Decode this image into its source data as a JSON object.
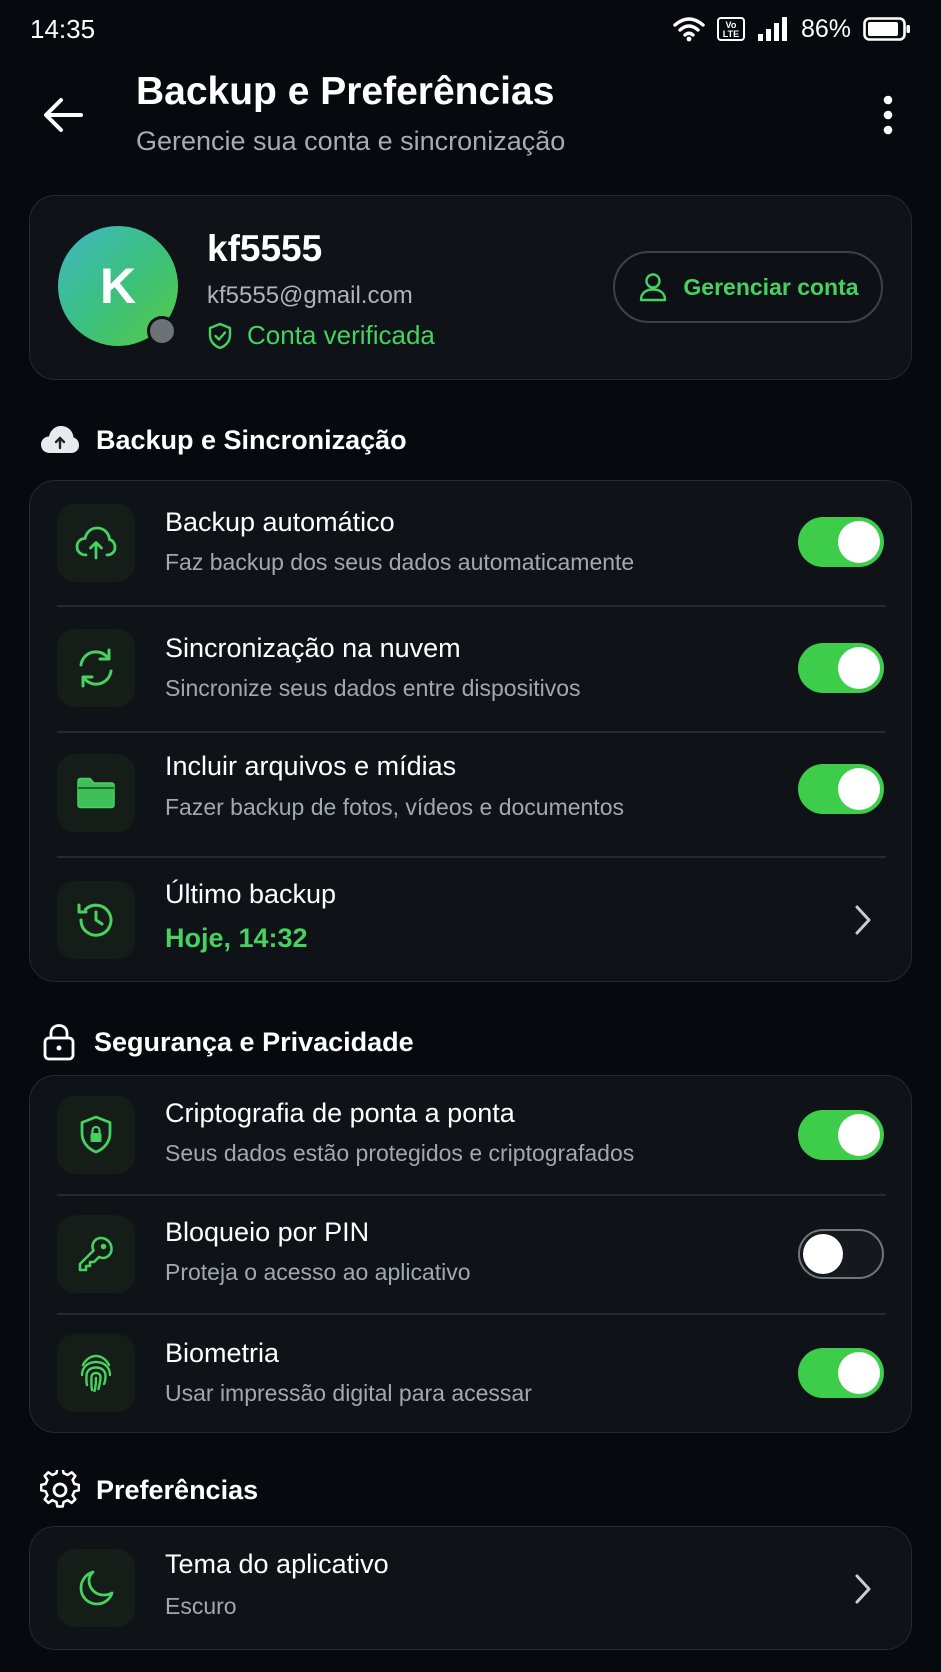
{
  "status_bar": {
    "time": "14:35",
    "volte": "Vo LTE",
    "battery": "86%"
  },
  "header": {
    "title": "Backup e Preferências",
    "subtitle": "Gerencie sua conta e sincronização"
  },
  "profile": {
    "initial": "K",
    "name": "kf5555",
    "email": "kf5555@gmail.com",
    "verified_label": "Conta verificada",
    "manage_label": "Gerenciar conta"
  },
  "sections": {
    "backup": {
      "title": "Backup e Sincronização",
      "items": [
        {
          "title": "Backup automático",
          "subtitle": "Faz backup dos seus dados automaticamente",
          "enabled": true
        },
        {
          "title": "Sincronização na nuvem",
          "subtitle": "Sincronize seus dados entre dispositivos",
          "enabled": true
        },
        {
          "title": "Incluir arquivos e mídias",
          "subtitle": "Fazer backup de fotos, vídeos e documentos",
          "enabled": true
        },
        {
          "title": "Último backup",
          "subtitle": "Hoje, 14:32"
        }
      ]
    },
    "security": {
      "title": "Segurança e Privacidade",
      "items": [
        {
          "title": "Criptografia de ponta a ponta",
          "subtitle": "Seus dados estão protegidos e criptografados",
          "enabled": true
        },
        {
          "title": "Bloqueio por PIN",
          "subtitle": "Proteja o acesso ao aplicativo",
          "enabled": false
        },
        {
          "title": "Biometria",
          "subtitle": "Usar impressão digital para acessar",
          "enabled": true
        }
      ]
    },
    "preferences": {
      "title": "Preferências",
      "items": [
        {
          "title": "Tema do aplicativo",
          "subtitle": "Escuro"
        }
      ]
    }
  },
  "colors": {
    "accent": "#46d160",
    "toggle_on": "#3ecc4b",
    "card_bg": "#0f1318",
    "page_bg": "#06090d"
  }
}
